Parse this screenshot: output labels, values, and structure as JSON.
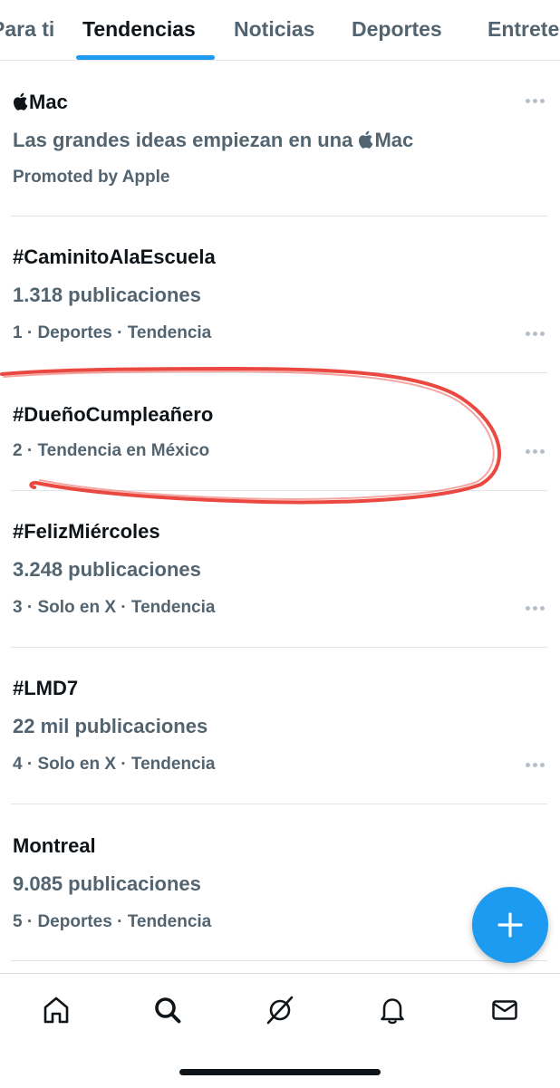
{
  "tabs": [
    {
      "label": "Para ti"
    },
    {
      "label": "Tendencias",
      "active": true
    },
    {
      "label": "Noticias"
    },
    {
      "label": "Deportes"
    },
    {
      "label": "Entretenimiento"
    }
  ],
  "promo": {
    "brand": "Mac",
    "headline_prefix": "Las grandes ideas empiezan en una ",
    "headline_brand": "Mac",
    "sponsor": "Promoted by Apple"
  },
  "trends": [
    {
      "name": "#CaminitoAlaEscuela",
      "posts": "1.318 publicaciones",
      "context": "1 · Deportes · Tendencia"
    },
    {
      "name": "#DueñoCumpleañero",
      "context": "2 · Tendencia en México"
    },
    {
      "name": "#FelizMiércoles",
      "posts": "3.248 publicaciones",
      "context": "3 · Solo en X · Tendencia"
    },
    {
      "name": "#LMD7",
      "posts": "22 mil publicaciones",
      "context": "4 · Solo en X · Tendencia"
    },
    {
      "name": "Montreal",
      "posts": "9.085 publicaciones",
      "context": "5 · Deportes · Tendencia"
    }
  ],
  "colors": {
    "accent": "#1d9bf0",
    "text_primary": "#0f1419",
    "text_secondary": "#536471",
    "annotation": "#e8342c"
  },
  "icons": {
    "fab": "plus-icon",
    "nav": [
      "home-icon",
      "search-icon",
      "grok-icon",
      "bell-icon",
      "mail-icon"
    ],
    "overflow": "more-horizontal-icon"
  }
}
